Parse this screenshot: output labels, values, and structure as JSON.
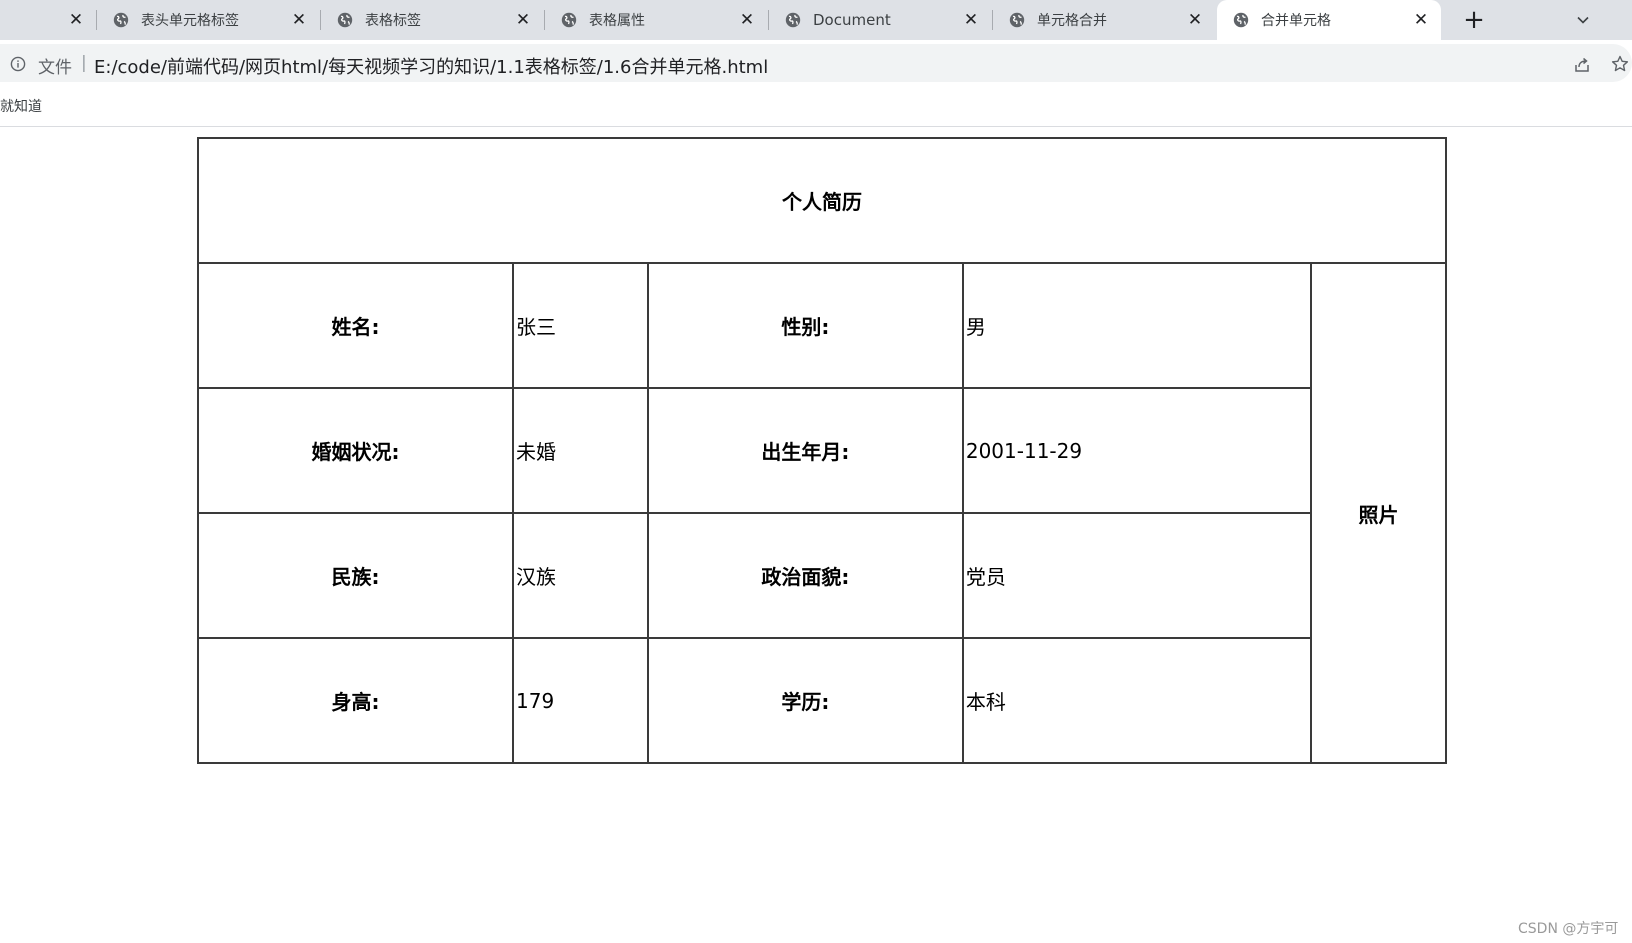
{
  "browser": {
    "tabs": [
      {
        "title": "",
        "active": false
      },
      {
        "title": "表头单元格标签",
        "active": false
      },
      {
        "title": "表格标签",
        "active": false
      },
      {
        "title": "表格属性",
        "active": false
      },
      {
        "title": "Document",
        "active": false
      },
      {
        "title": "单元格合并",
        "active": false
      },
      {
        "title": "合并单元格",
        "active": true
      }
    ],
    "new_tab_label": "+",
    "close_glyph": "✕",
    "address": {
      "scheme_label": "文件",
      "separator": "|",
      "url": "E:/code/前端代码/网页html/每天视频学习的知识/1.1表格标签/1.6合并单元格.html"
    },
    "bookmarks": [
      "就知道"
    ]
  },
  "page": {
    "table": {
      "title": "个人简历",
      "photo_label": "照片",
      "rows": [
        {
          "label1": "姓名:",
          "value1": "张三",
          "label2": "性别:",
          "value2": "男"
        },
        {
          "label1": "婚姻状况:",
          "value1": "未婚",
          "label2": "出生年月:",
          "value2": "2001-11-29"
        },
        {
          "label1": "民族:",
          "value1": "汉族",
          "label2": "政治面貌:",
          "value2": "党员"
        },
        {
          "label1": "身高:",
          "value1": "179",
          "label2": "学历:",
          "value2": "本科"
        }
      ]
    },
    "watermark": "CSDN @方宇可"
  },
  "colors": {
    "tab_strip": "#dee1e6",
    "active_tab": "#ffffff",
    "omnibox": "#f1f3f4",
    "table_border": "#3a3a3a"
  },
  "icons": {
    "tab_favicon": "globe-icon",
    "address_info": "info-icon",
    "share": "share-icon",
    "bookmark_star": "star-icon",
    "tab_search": "chevron-down-icon"
  }
}
